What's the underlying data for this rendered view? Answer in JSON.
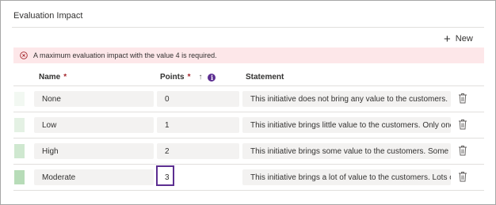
{
  "section": {
    "title": "Evaluation Impact"
  },
  "toolbar": {
    "new_label": "New"
  },
  "error": {
    "message": "A maximum evaluation impact with the value 4 is required."
  },
  "table": {
    "columns": {
      "name": "Name",
      "points": "Points",
      "statement": "Statement"
    },
    "rows": [
      {
        "name": "None",
        "points": "0",
        "statement": "This initiative does not bring any value to the customers.",
        "color": "#f2f8f2"
      },
      {
        "name": "Low",
        "points": "1",
        "statement": "This initiative brings little value to the customers. Only one or",
        "color": "#e4f1e4"
      },
      {
        "name": "High",
        "points": "2",
        "statement": "This initiative brings some value to the customers. Some custo",
        "color": "#cfe8d0"
      },
      {
        "name": "Moderate",
        "points": "3",
        "statement": "This initiative brings a lot of value to the customers. Lots of cu",
        "color": "#b7dcb8"
      }
    ]
  },
  "colors": {
    "error_bg": "#fde7e9",
    "error_icon": "#a4262c",
    "focus": "#5c2e91"
  },
  "icons": {
    "new": "plus-icon",
    "error": "error-circle-icon",
    "sort": "sort-ascending-icon",
    "info": "info-icon",
    "delete": "trash-icon"
  }
}
